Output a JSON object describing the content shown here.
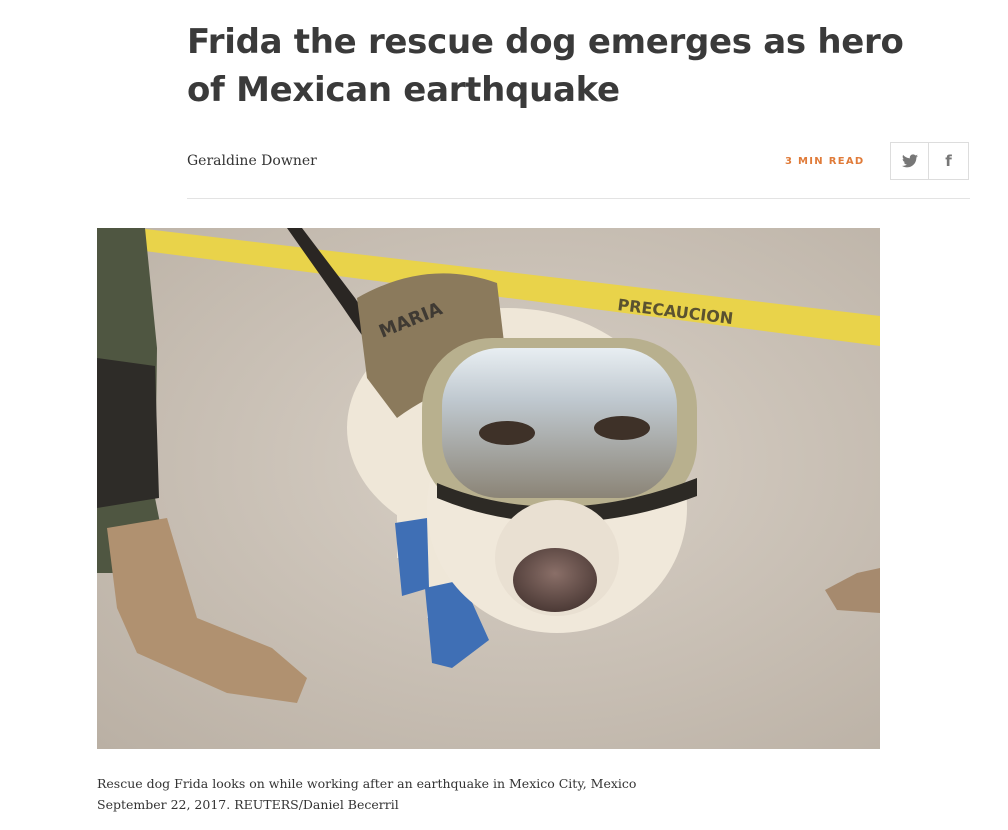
{
  "article": {
    "title": "Frida the rescue dog emerges as hero of Mexican earthquake",
    "author": "Geraldine Downer",
    "read_time": "3 MIN READ"
  },
  "share": {
    "twitter_icon": "twitter-icon",
    "facebook_icon": "facebook-icon",
    "facebook_glyph": "f"
  },
  "photo": {
    "tape_text": "PRECAUCION",
    "harness_text": "MARIA",
    "caption": "Rescue dog Frida looks on while working after an earthquake in Mexico City, Mexico September 22, 2017. REUTERS/Daniel Becerril"
  },
  "colors": {
    "accent": "#e07b39",
    "text": "#333333",
    "caution_tape": "#e9d34a",
    "boot_blue": "#3f6fb5"
  }
}
